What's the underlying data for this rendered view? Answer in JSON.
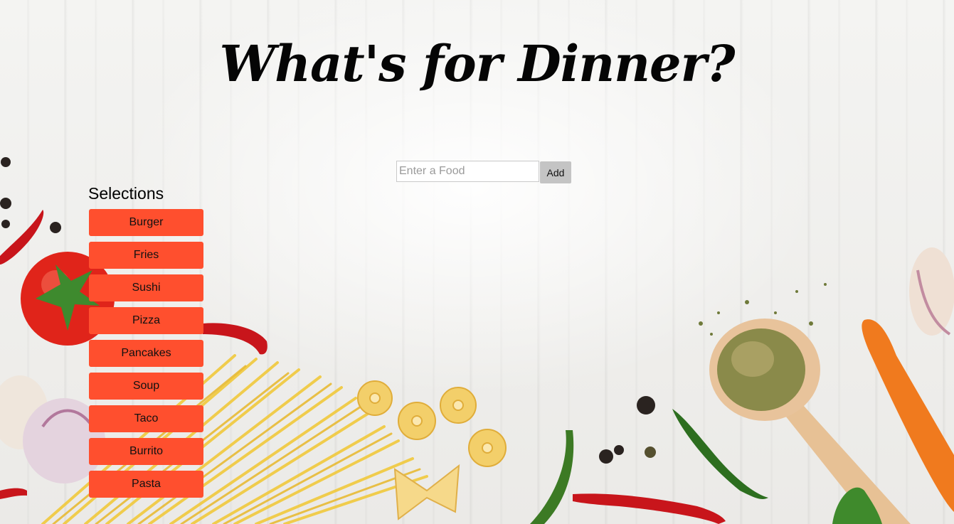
{
  "header": {
    "title": "What's for Dinner?"
  },
  "add_form": {
    "placeholder": "Enter a Food",
    "value": "",
    "add_label": "Add"
  },
  "selections": {
    "heading": "Selections",
    "items": [
      {
        "label": "Burger"
      },
      {
        "label": "Fries"
      },
      {
        "label": "Sushi"
      },
      {
        "label": "Pizza"
      },
      {
        "label": "Pancakes"
      },
      {
        "label": "Soup"
      },
      {
        "label": "Taco"
      },
      {
        "label": "Burrito"
      },
      {
        "label": "Pasta"
      }
    ]
  },
  "colors": {
    "selection_button": "#ff4f2e",
    "add_button": "#c4c4c4",
    "title": "#050505"
  }
}
